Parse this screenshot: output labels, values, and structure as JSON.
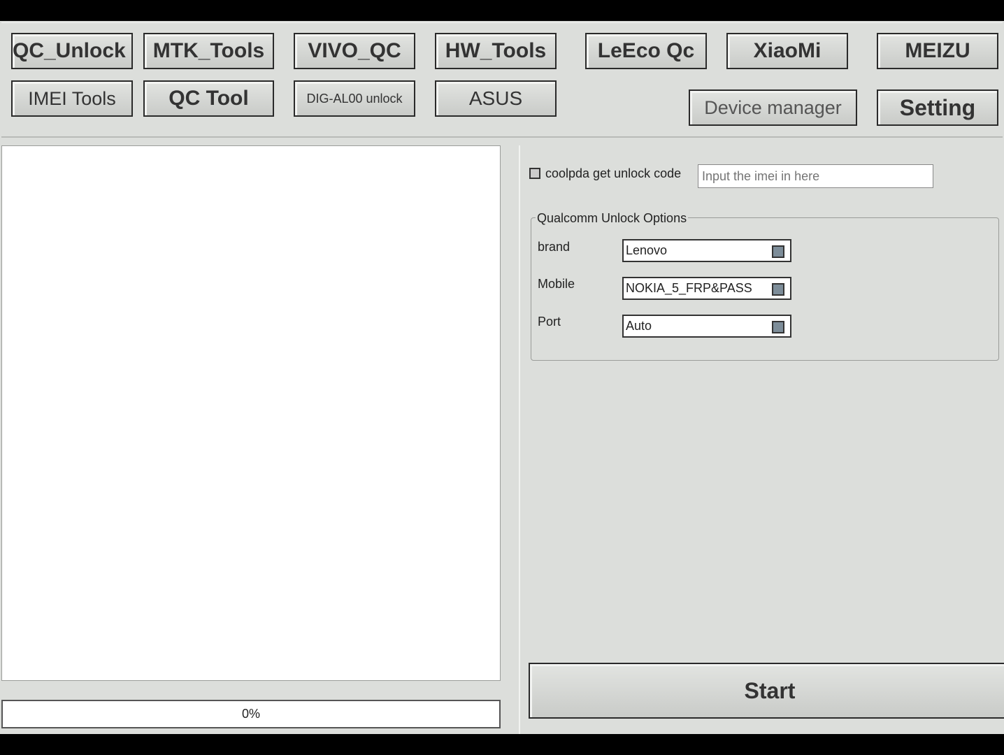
{
  "toolbar": {
    "row1": [
      "QC_Unlock",
      "MTK_Tools",
      "VIVO_QC",
      "HW_Tools",
      "LeEco Qc",
      "XiaoMi",
      "MEIZU"
    ],
    "row2": [
      "IMEI Tools",
      "QC Tool",
      "DIG-AL00 unlock",
      "ASUS"
    ],
    "device_manager": "Device manager",
    "setting": "Setting"
  },
  "progress": {
    "label": "0%",
    "value": 0
  },
  "coolpda": {
    "label": "coolpda get unlock code",
    "checked": false,
    "placeholder": "Input the imei in here"
  },
  "qualcomm": {
    "title": "Qualcomm Unlock Options",
    "brand_label": "brand",
    "brand_value": "Lenovo",
    "mobile_label": "Mobile",
    "mobile_value": "NOKIA_5_FRP&PASS",
    "port_label": "Port",
    "port_value": "Auto"
  },
  "start_label": "Start"
}
